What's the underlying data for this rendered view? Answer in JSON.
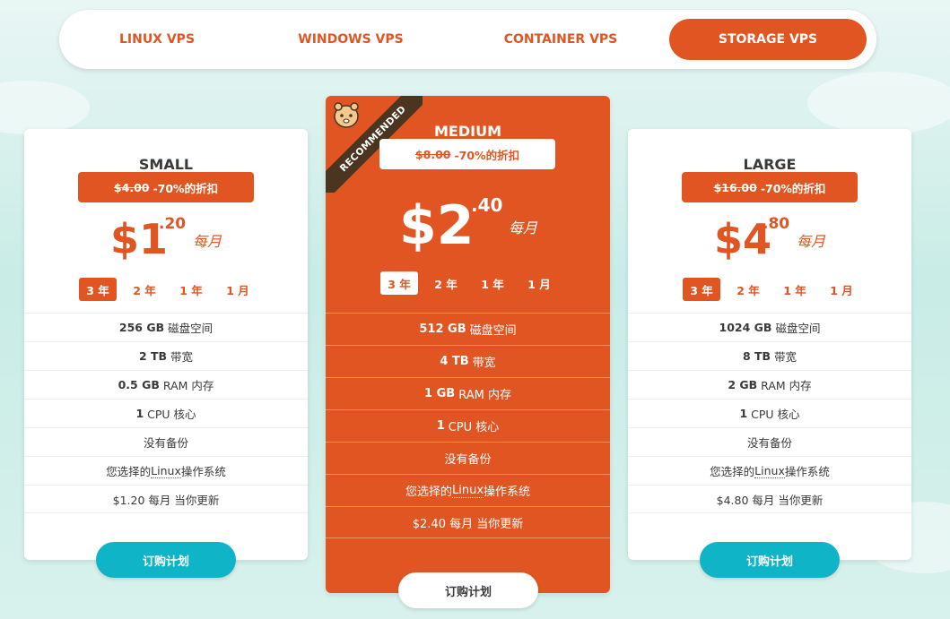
{
  "tabs": [
    {
      "label": "LINUX VPS",
      "active": false
    },
    {
      "label": "WINDOWS VPS",
      "active": false
    },
    {
      "label": "CONTAINER VPS",
      "active": false
    },
    {
      "label": "STORAGE VPS",
      "active": true
    }
  ],
  "colors": {
    "accent": "#e05522",
    "button": "#0fb4c7",
    "ribbon": "#4a3520"
  },
  "plans": {
    "small": {
      "name": "SMALL",
      "old_price": "$4.00",
      "discount": "-70%的折扣",
      "price_dollar": "$1",
      "price_cents": ".20",
      "period": "每月",
      "terms": [
        "3 年",
        "2 年",
        "1 年",
        "1 月"
      ],
      "active_term": "3 年",
      "features": {
        "disk_value": "256 GB",
        "disk_label": "磁盘空间",
        "bw_value": "2 TB",
        "bw_label": "带宽",
        "ram_value": "0.5 GB",
        "ram_label": "RAM 内存",
        "cpu_value": "1",
        "cpu_label": "CPU 核心",
        "backup": "没有备份",
        "os_pre": "您选择的",
        "os_link": "Linux",
        "os_post": "操作系统",
        "renew": "$1.20 每月 当你更新"
      },
      "buy_label": "订购计划"
    },
    "medium": {
      "ribbon": "RECOMMENDED",
      "name": "MEDIUM",
      "old_price": "$8.00",
      "discount": "-70%的折扣",
      "price_dollar": "$2",
      "price_cents": ".40",
      "period": "每月",
      "terms": [
        "3 年",
        "2 年",
        "1 年",
        "1 月"
      ],
      "active_term": "3 年",
      "features": {
        "disk_value": "512 GB",
        "disk_label": "磁盘空间",
        "bw_value": "4 TB",
        "bw_label": "带宽",
        "ram_value": "1 GB",
        "ram_label": "RAM 内存",
        "cpu_value": "1",
        "cpu_label": "CPU 核心",
        "backup": "没有备份",
        "os_pre": "您选择的",
        "os_link": "Linux",
        "os_post": "操作系统",
        "renew": "$2.40 每月 当你更新"
      },
      "buy_label": "订购计划"
    },
    "large": {
      "name": "LARGE",
      "old_price": "$16.00",
      "discount": "-70%的折扣",
      "price_dollar": "$4",
      "price_cents": ".80",
      "period": "每月",
      "terms": [
        "3 年",
        "2 年",
        "1 年",
        "1 月"
      ],
      "active_term": "3 年",
      "features": {
        "disk_value": "1024 GB",
        "disk_label": "磁盘空间",
        "bw_value": "8 TB",
        "bw_label": "带宽",
        "ram_value": "2 GB",
        "ram_label": "RAM 内存",
        "cpu_value": "1",
        "cpu_label": "CPU 核心",
        "backup": "没有备份",
        "os_pre": "您选择的",
        "os_link": "Linux",
        "os_post": "操作系统",
        "renew": "$4.80 每月 当你更新"
      },
      "buy_label": "订购计划"
    }
  }
}
